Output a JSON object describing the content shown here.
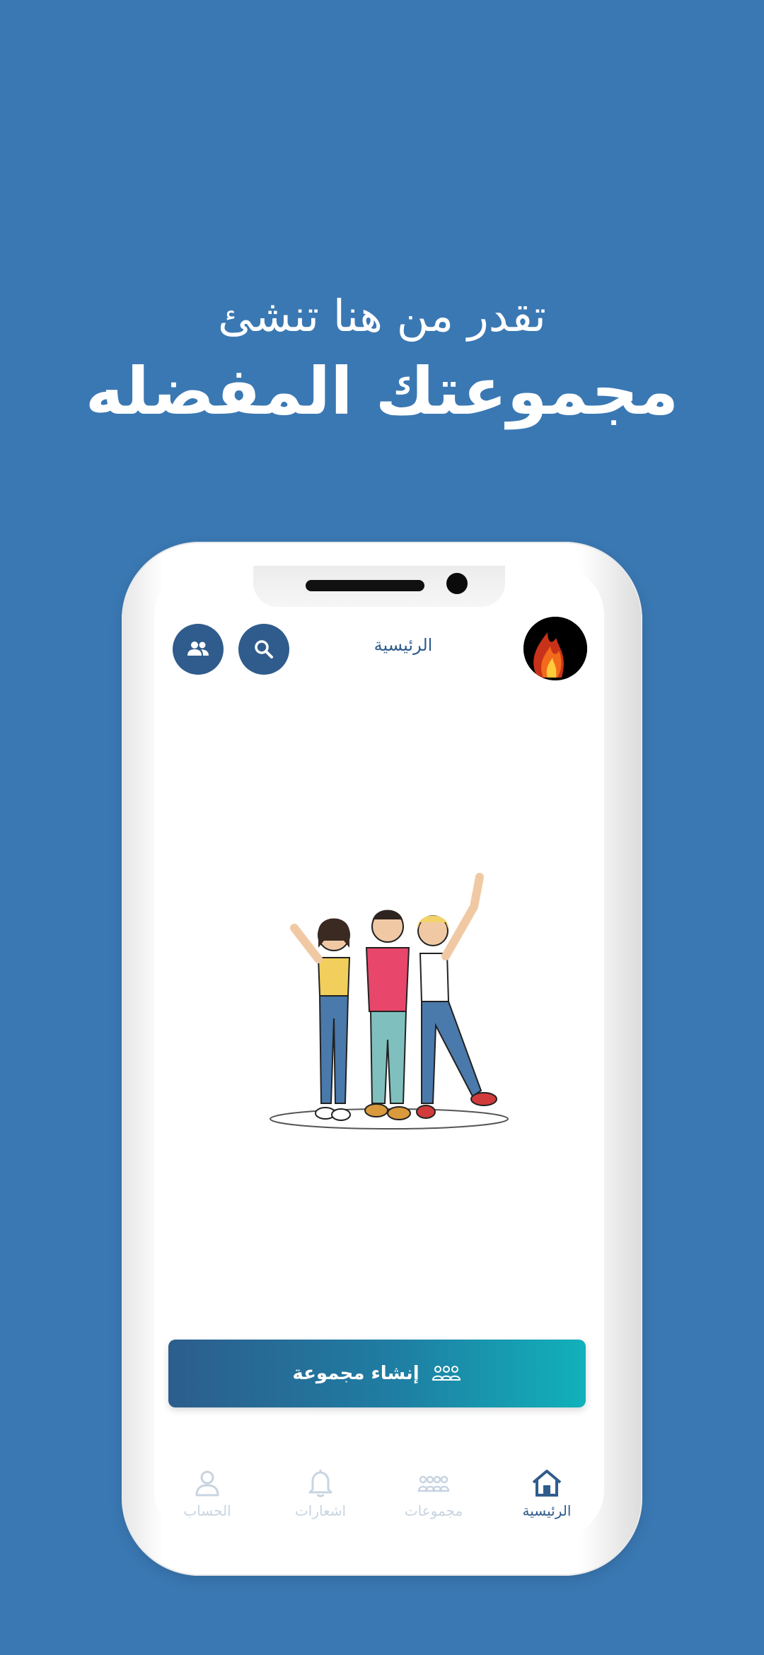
{
  "promo": {
    "line1": "تقدر من هنا تنشئ",
    "line2": "مجموعتك المفضله"
  },
  "header": {
    "title": "الرئيسية",
    "groups_icon": "people-icon",
    "search_icon": "search-icon",
    "avatar": "fire-avatar"
  },
  "main": {
    "illustration": "three-friends-illustration",
    "create_group_label": "إنشاء مجموعة",
    "create_group_icon": "group-icon"
  },
  "bottom_nav": {
    "items": [
      {
        "label": "الرئيسية",
        "icon": "home-icon",
        "active": true
      },
      {
        "label": "مجموعات",
        "icon": "groups-icon",
        "active": false
      },
      {
        "label": "اشعارات",
        "icon": "bell-icon",
        "active": false
      },
      {
        "label": "الحساب",
        "icon": "user-icon",
        "active": false
      }
    ]
  },
  "colors": {
    "background": "#3a78b3",
    "primary": "#2f5c8c",
    "gradient_end": "#11b1bb",
    "inactive_nav": "#c8d4e1"
  }
}
